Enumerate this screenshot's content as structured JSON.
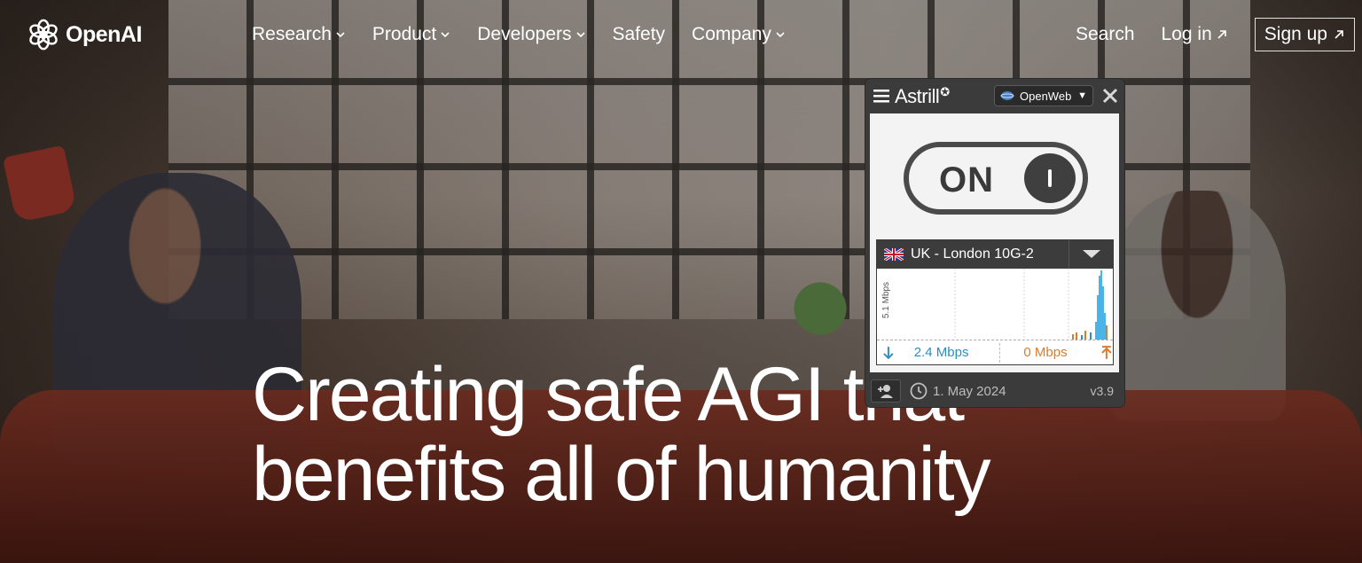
{
  "nav": {
    "brand": "OpenAI",
    "menu": [
      {
        "label": "Research"
      },
      {
        "label": "Product"
      },
      {
        "label": "Developers"
      },
      {
        "label": "Safety"
      },
      {
        "label": "Company"
      }
    ],
    "search": "Search",
    "login": "Log in",
    "signup": "Sign up"
  },
  "hero": {
    "line1": "Creating safe AGI that",
    "line2": "benefits all of humanity"
  },
  "astrill": {
    "brand": "Astrill",
    "brand_mark": "✪",
    "mode": "OpenWeb",
    "toggle_state": "ON",
    "server": "UK - London 10G-2",
    "graph_ylabel": "5.1 Mbps",
    "download_speed": "2.4 Mbps",
    "upload_speed": "0 Mbps",
    "date": "1. May 2024",
    "version": "v3.9",
    "colors": {
      "download": "#2a8fc0",
      "upload": "#e07a2a",
      "panel": "#3b3b3b"
    }
  },
  "icons": [
    "openai-logo-icon",
    "chevron-down-icon",
    "arrow-up-right-icon",
    "hamburger-menu-icon",
    "globe-icon",
    "close-icon",
    "uk-flag-icon",
    "download-arrow-icon",
    "upload-arrow-icon",
    "add-user-icon",
    "clock-icon"
  ]
}
